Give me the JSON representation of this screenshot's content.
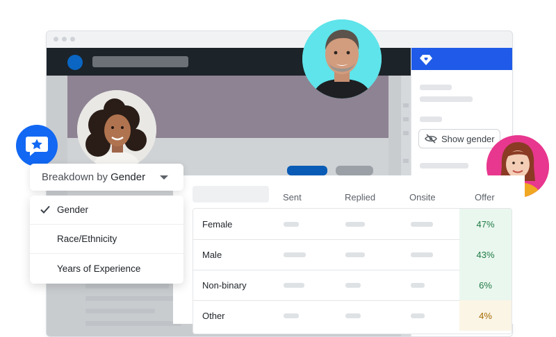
{
  "panel": {
    "show_gender_label": "Show gender"
  },
  "breakdown": {
    "prefix": "Breakdown by",
    "selected": "Gender"
  },
  "menu": {
    "items": [
      {
        "label": "Gender",
        "checked": true
      },
      {
        "label": "Race/Ethnicity",
        "checked": false
      },
      {
        "label": "Years of Experience",
        "checked": false
      }
    ]
  },
  "table": {
    "columns": [
      "Sent",
      "Replied",
      "Onsite",
      "Offer"
    ],
    "rows": [
      {
        "label": "Female",
        "offer": "47%"
      },
      {
        "label": "Male",
        "offer": "43%"
      },
      {
        "label": "Non-binary",
        "offer": "6%"
      },
      {
        "label": "Other",
        "offer": "4%"
      }
    ]
  },
  "colors": {
    "brand_blue": "#1f5be8",
    "chat_badge": "#1268f3",
    "offer_green_bg": "#eaf7ef",
    "offer_green_text": "#1f7a44",
    "offer_amber_bg": "#fbf5e6",
    "offer_amber_text": "#a36a00",
    "app_bar": "#1c2329"
  },
  "icons": {
    "panel_logo": "diamond-heart-icon",
    "show_gender": "eye-slash-icon",
    "chat_badge": "chat-star-icon",
    "dropdown": "caret-down-icon",
    "check": "check-icon"
  }
}
